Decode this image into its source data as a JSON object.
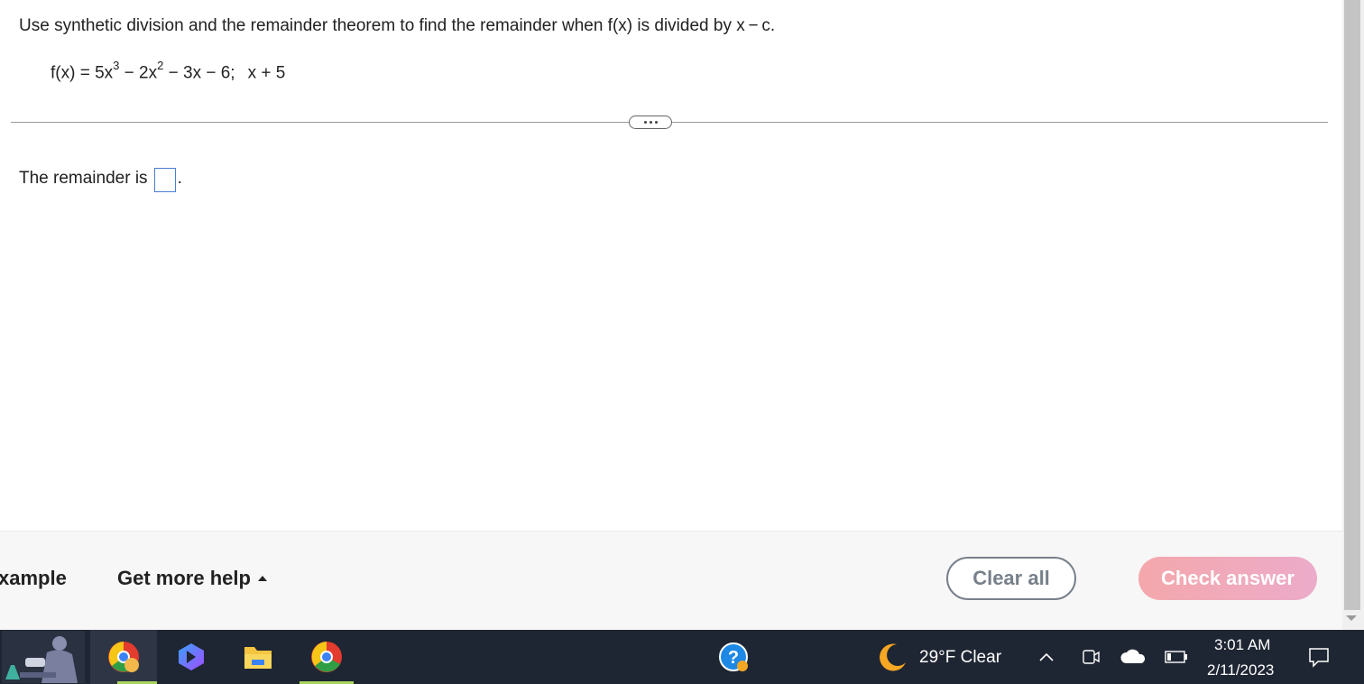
{
  "question": {
    "instruction": "Use synthetic division and the remainder theorem to find the remainder when f(x) is divided by x − c.",
    "equation": {
      "lhs": "f(x) = 5x",
      "exp1": "3",
      "mid1": " − 2x",
      "exp2": "2",
      "rest": " − 3x − 6;",
      "divisor": "x + 5"
    },
    "answer_prefix": "The remainder is",
    "answer_value": "",
    "answer_suffix": "."
  },
  "bottom_bar": {
    "example_label": "xample",
    "help_label": "Get more help",
    "clear_label": "Clear all",
    "check_label": "Check answer"
  },
  "taskbar": {
    "weather": "29°F  Clear",
    "time": "3:01 AM",
    "date": "2/11/2023"
  },
  "colors": {
    "accent": "#2a7fa8",
    "check_button": "#f0a9b8",
    "answer_box_border": "#4a7fd1",
    "taskbar": "#1f2633"
  },
  "icons": [
    "ellipsis-icon",
    "caret-up-icon",
    "science-app-icon",
    "chrome-icon",
    "bing-icon",
    "file-explorer-icon",
    "chrome-icon",
    "help-icon",
    "moon-icon",
    "chevron-up-icon",
    "meet-now-icon",
    "onedrive-icon",
    "battery-icon",
    "notification-icon"
  ]
}
